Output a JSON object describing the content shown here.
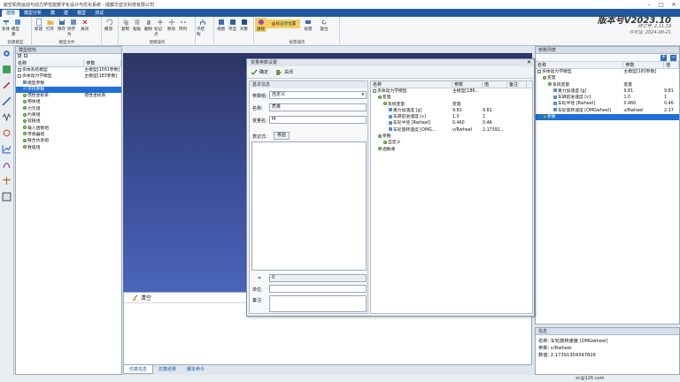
{
  "window": {
    "title": "航空机构运动与动力学性能数字化设计与优化系统 - 成都华亚文科技有限公司",
    "controls": [
      "–",
      "□",
      "✕"
    ]
  },
  "menu": {
    "tabs": [
      "建模",
      "模型分析",
      "模",
      "建",
      "模型",
      "测试"
    ],
    "active": 0
  },
  "ribbon": {
    "groups": [
      {
        "label": "新建模型",
        "buttons": [
          "多体",
          "模型库"
        ]
      },
      {
        "label": "模型文件",
        "buttons": [
          "新建",
          "打开",
          "保存",
          "另存为",
          "关闭"
        ]
      },
      {
        "label": "",
        "buttons": [
          "撤消"
        ]
      },
      {
        "label": "建模操作",
        "buttons": [
          "复制",
          "粘贴",
          "删除",
          "标记点",
          "移动",
          "阵列"
        ]
      },
      {
        "label": "",
        "buttons": [
          "子结构"
        ]
      },
      {
        "label": "",
        "buttons": [
          "视图",
          "突显",
          "对象"
        ]
      },
      {
        "label": "视景操作",
        "buttons": [
          "透视",
          "标记点位置",
          "视景",
          "复位"
        ]
      }
    ]
  },
  "version": {
    "title": "版本号V2023.10",
    "date1": "修订号: 2.11.19",
    "date2": "许可证: 2024-08-21"
  },
  "left_panel": {
    "title": "模型结构",
    "col_name": "名称",
    "col_param": "参数",
    "rows": [
      {
        "name": "多体系统模型",
        "param": "主模型[1581参数]",
        "indent": 0,
        "kind": "pm"
      },
      {
        "name": "多体动力学模型",
        "param": "主模型[183参数]",
        "indent": 0,
        "kind": "pm"
      },
      {
        "name": "模型参数",
        "param": "",
        "indent": 1,
        "kind": "sq"
      },
      {
        "name": "字符参数",
        "param": "",
        "indent": 1,
        "kind": "sq",
        "selected": true
      },
      {
        "name": "惯性坐标系",
        "param": "惯性坐标系",
        "indent": 1,
        "kind": "nd"
      },
      {
        "name": "物体组",
        "param": "",
        "indent": 1,
        "kind": "nd"
      },
      {
        "name": "力元组",
        "param": "",
        "indent": 1,
        "kind": "nd"
      },
      {
        "name": "约束组",
        "param": "",
        "indent": 1,
        "kind": "nd"
      },
      {
        "name": "铰链组",
        "param": "",
        "indent": 1,
        "kind": "nd"
      },
      {
        "name": "输入函数组",
        "param": "",
        "indent": 1,
        "kind": "nd"
      },
      {
        "name": "传感器组",
        "param": "",
        "indent": 1,
        "kind": "nd"
      },
      {
        "name": "联合仿真组",
        "param": "",
        "indent": 1,
        "kind": "nd"
      },
      {
        "name": "数值组",
        "param": "",
        "indent": 1,
        "kind": "nd"
      }
    ]
  },
  "bottom": {
    "tabs": [
      "仿真信息",
      "仿真结果",
      "脚本命令"
    ],
    "active": 0,
    "clear_label": "清空"
  },
  "dialog": {
    "title": "变量参数设置",
    "confirm": "确定",
    "close": "关闭",
    "basic_info": "基本信息",
    "param_group_label": "参数组:",
    "param_group_value": "自定义",
    "name_label": "名称:",
    "name_value": "质量",
    "var_label": "变量名:",
    "var_value": "M",
    "expr_label": "表达式:",
    "check_label": "校验",
    "equals": "=",
    "equals_value": "0",
    "unit_label": "单位:",
    "remark_label": "备注:",
    "tree": {
      "headers": [
        "名称",
        "参数",
        "值",
        "备注"
      ],
      "rows": [
        {
          "name": "多体动力学模型",
          "param": "主模型[186...",
          "val": "",
          "note": "",
          "indent": 0,
          "kind": "pm"
        },
        {
          "name": "变量",
          "param": "",
          "val": "",
          "note": "",
          "indent": 1,
          "kind": "nd"
        },
        {
          "name": "系统变量",
          "param": "变量",
          "val": "",
          "note": "",
          "indent": 2,
          "kind": "nd"
        },
        {
          "name": "重力加速度 [g]",
          "param": "9.81",
          "val": "9.81",
          "note": "",
          "indent": 3,
          "kind": "sq"
        },
        {
          "name": "车辆前进速度 [v]",
          "param": "1.0",
          "val": "1",
          "note": "",
          "indent": 3,
          "kind": "sq"
        },
        {
          "name": "车轮半径 [Rwheel]",
          "param": "0.460",
          "val": "0.46",
          "note": "",
          "indent": 3,
          "kind": "sq"
        },
        {
          "name": "车轮旋转速度 [OMG...",
          "param": "v/Rwheel",
          "val": "2.17391...",
          "note": "",
          "indent": 3,
          "kind": "sq"
        },
        {
          "name": "参数",
          "param": "",
          "val": "",
          "note": "",
          "indent": 1,
          "kind": "nd"
        },
        {
          "name": "自定义",
          "param": "",
          "val": "",
          "note": "",
          "indent": 2,
          "kind": "nd"
        },
        {
          "name": "函数库",
          "param": "",
          "val": "",
          "note": "",
          "indent": 1,
          "kind": "nd"
        }
      ]
    }
  },
  "right_panel": {
    "title": "参数列表",
    "col_name": "名称",
    "col_param": "参数",
    "col_val": "值",
    "rows": [
      {
        "name": "多体动力学模型",
        "param": "主模型[183参数]",
        "val": "",
        "indent": 0,
        "kind": "pm"
      },
      {
        "name": "变量",
        "param": "",
        "val": "",
        "indent": 1,
        "kind": "nd"
      },
      {
        "name": "系统变量",
        "param": "变量",
        "val": "",
        "indent": 2,
        "kind": "nd"
      },
      {
        "name": "重力加速度 [g]",
        "param": "9.81",
        "val": "9.81",
        "indent": 3,
        "kind": "sq"
      },
      {
        "name": "车辆前进速度 [v]",
        "param": "1.0",
        "val": "1",
        "indent": 3,
        "kind": "sq"
      },
      {
        "name": "车轮半径 [Rwheel]",
        "param": "0.460",
        "val": "0.46",
        "indent": 3,
        "kind": "sq"
      },
      {
        "name": "车轮旋转速度 [OMGwheel]",
        "param": "v/Rwheel",
        "val": "2.17",
        "indent": 3,
        "kind": "sq"
      },
      {
        "name": "参数",
        "param": "",
        "val": "",
        "indent": 1,
        "kind": "nd",
        "selected": true
      }
    ],
    "info_title": "信息",
    "info_name": "名称: 车轮旋转速度 [OMGwheel]",
    "info_param": "参数: v/Rwheel",
    "info_value": "数值: 2.17391304347826"
  },
  "status": {
    "text": "xc@126.com"
  }
}
